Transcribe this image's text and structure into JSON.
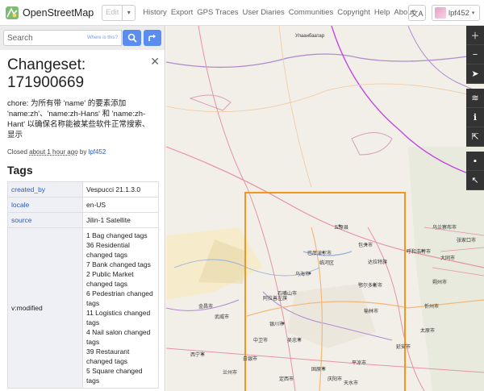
{
  "header": {
    "site_name": "OpenStreetMap",
    "edit_label": "Edit",
    "nav": [
      "History",
      "Export",
      "GPS Traces",
      "User Diaries",
      "Communities",
      "Copyright",
      "Help",
      "About"
    ],
    "username": "lpf452",
    "lang_glyph": "文A"
  },
  "search": {
    "placeholder": "Search",
    "where_link": "Where is this?"
  },
  "changeset": {
    "title": "Changeset: 171900669",
    "comment": "chore: 为所有带 'name' 的要素添加 'name:zh'、'name:zh-Hans' 和 'name:zh-Hant' 以确保名称能被某些软件正常搜索、显示",
    "closed_prefix": "Closed",
    "closed_time": "about 1 hour ago",
    "by": "by",
    "user": "lpf452"
  },
  "tags_heading": "Tags",
  "tags": [
    {
      "key": "created_by",
      "value": "Vespucci 21.1.3.0"
    },
    {
      "key": "locale",
      "value": "en-US"
    },
    {
      "key": "source",
      "value": "Jilin-1 Satellite"
    },
    {
      "key": "v:modified",
      "value": "1 Bag changed tags\n36 Residential changed tags\n7 Bank changed tags\n2 Public Market changed tags\n6 Pedestrian changed tags\n11 Logistics changed tags\n4 Nail salon changed tags\n39 Restaurant changed tags\n5 Square changed tags"
    }
  ],
  "map": {
    "labels": [
      "Улаанбаатар",
      "五原县",
      "巴彦淖尔市",
      "乌海市",
      "鄂尔多斯市",
      "银川市",
      "吴忠市",
      "中卫市",
      "固原市",
      "平凉市",
      "西宁市",
      "兰州市",
      "金昌市",
      "武威市",
      "白银市",
      "定西市",
      "天水市",
      "呼和浩特市",
      "包头市",
      "大同市",
      "朔州市",
      "忻州市",
      "太原市",
      "张家口市",
      "榆林市",
      "延安市",
      "庆阳市",
      "石嘴山市",
      "阿拉善左旗",
      "乌兰察布市",
      "临河区",
      "达拉特旗"
    ]
  }
}
